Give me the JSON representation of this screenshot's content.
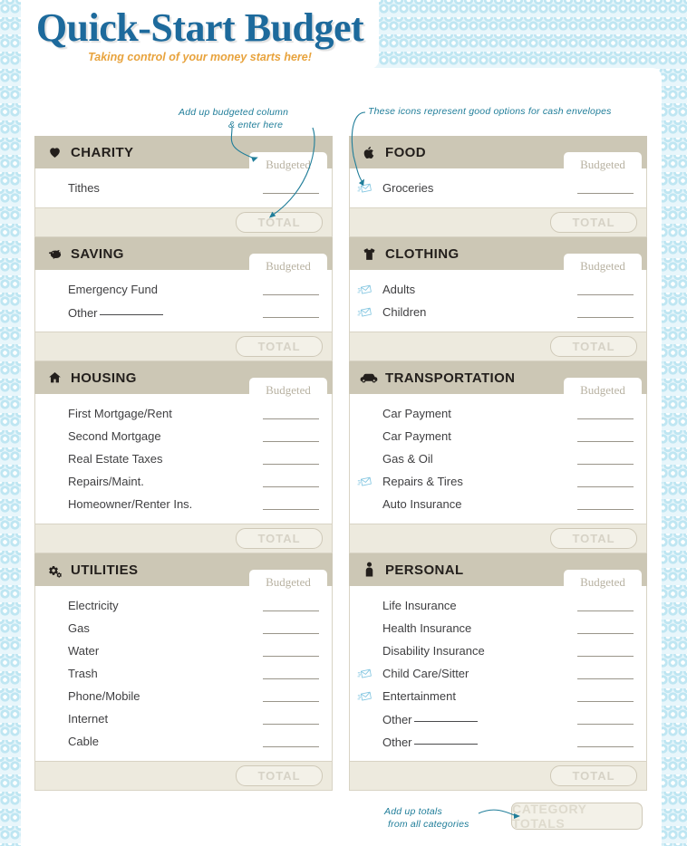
{
  "page": {
    "title": "Quick-Start Budget",
    "subtitle": "Taking control of your money starts here!",
    "accent_blue": "#1d6a9c",
    "accent_orange": "#e8a33d",
    "header_bar_color": "#ccc7b5",
    "total_row_color": "#edeade",
    "annotation_color": "#1f7d99",
    "envelope_icon_color": "#7fc4e0",
    "background_color": "#e8f6fb"
  },
  "labels": {
    "budgeted": "Budgeted",
    "total": "TOTAL",
    "category_totals": "CATEGORY TOTALS"
  },
  "annotations": [
    {
      "id": "add-up-budgeted",
      "line1": "Add up budgeted column",
      "line2": "& enter here"
    },
    {
      "id": "cash-envelopes",
      "line1": "These icons represent good options for cash envelopes"
    },
    {
      "id": "add-up-totals",
      "line1": "Add up totals",
      "line2": "from all categories"
    }
  ],
  "columns": [
    {
      "name": "left",
      "sections": [
        {
          "id": "charity",
          "title": "CHARITY",
          "icon": "heart-icon",
          "items": [
            {
              "label": "Tithes",
              "envelope": false,
              "blank": false
            }
          ]
        },
        {
          "id": "saving",
          "title": "SAVING",
          "icon": "piggy-bank-icon",
          "items": [
            {
              "label": "Emergency Fund",
              "envelope": false,
              "blank": false
            },
            {
              "label": "Other",
              "envelope": false,
              "blank": true
            }
          ]
        },
        {
          "id": "housing",
          "title": "HOUSING",
          "icon": "house-icon",
          "items": [
            {
              "label": "First Mortgage/Rent",
              "envelope": false,
              "blank": false
            },
            {
              "label": "Second Mortgage",
              "envelope": false,
              "blank": false
            },
            {
              "label": "Real Estate Taxes",
              "envelope": false,
              "blank": false
            },
            {
              "label": "Repairs/Maint.",
              "envelope": false,
              "blank": false
            },
            {
              "label": "Homeowner/Renter Ins.",
              "envelope": false,
              "blank": false
            }
          ]
        },
        {
          "id": "utilities",
          "title": "UTILITIES",
          "icon": "gears-icon",
          "items": [
            {
              "label": "Electricity",
              "envelope": false,
              "blank": false
            },
            {
              "label": "Gas",
              "envelope": false,
              "blank": false
            },
            {
              "label": "Water",
              "envelope": false,
              "blank": false
            },
            {
              "label": "Trash",
              "envelope": false,
              "blank": false
            },
            {
              "label": "Phone/Mobile",
              "envelope": false,
              "blank": false
            },
            {
              "label": "Internet",
              "envelope": false,
              "blank": false
            },
            {
              "label": "Cable",
              "envelope": false,
              "blank": false
            }
          ]
        }
      ]
    },
    {
      "name": "right",
      "sections": [
        {
          "id": "food",
          "title": "FOOD",
          "icon": "apple-icon",
          "items": [
            {
              "label": "Groceries",
              "envelope": true,
              "blank": false
            }
          ]
        },
        {
          "id": "clothing",
          "title": "CLOTHING",
          "icon": "tshirt-icon",
          "items": [
            {
              "label": "Adults",
              "envelope": true,
              "blank": false
            },
            {
              "label": "Children",
              "envelope": true,
              "blank": false
            }
          ]
        },
        {
          "id": "transportation",
          "title": "TRANSPORTATION",
          "icon": "car-icon",
          "items": [
            {
              "label": "Car Payment",
              "envelope": false,
              "blank": false
            },
            {
              "label": "Car Payment",
              "envelope": false,
              "blank": false
            },
            {
              "label": "Gas & Oil",
              "envelope": false,
              "blank": false
            },
            {
              "label": "Repairs & Tires",
              "envelope": true,
              "blank": false
            },
            {
              "label": "Auto Insurance",
              "envelope": false,
              "blank": false
            }
          ]
        },
        {
          "id": "personal",
          "title": "PERSONAL",
          "icon": "person-icon",
          "items": [
            {
              "label": "Life Insurance",
              "envelope": false,
              "blank": false
            },
            {
              "label": "Health Insurance",
              "envelope": false,
              "blank": false
            },
            {
              "label": "Disability Insurance",
              "envelope": false,
              "blank": false
            },
            {
              "label": "Child Care/Sitter",
              "envelope": true,
              "blank": false
            },
            {
              "label": "Entertainment",
              "envelope": true,
              "blank": false
            },
            {
              "label": "Other",
              "envelope": false,
              "blank": true
            },
            {
              "label": "Other",
              "envelope": false,
              "blank": true
            }
          ]
        }
      ]
    }
  ]
}
